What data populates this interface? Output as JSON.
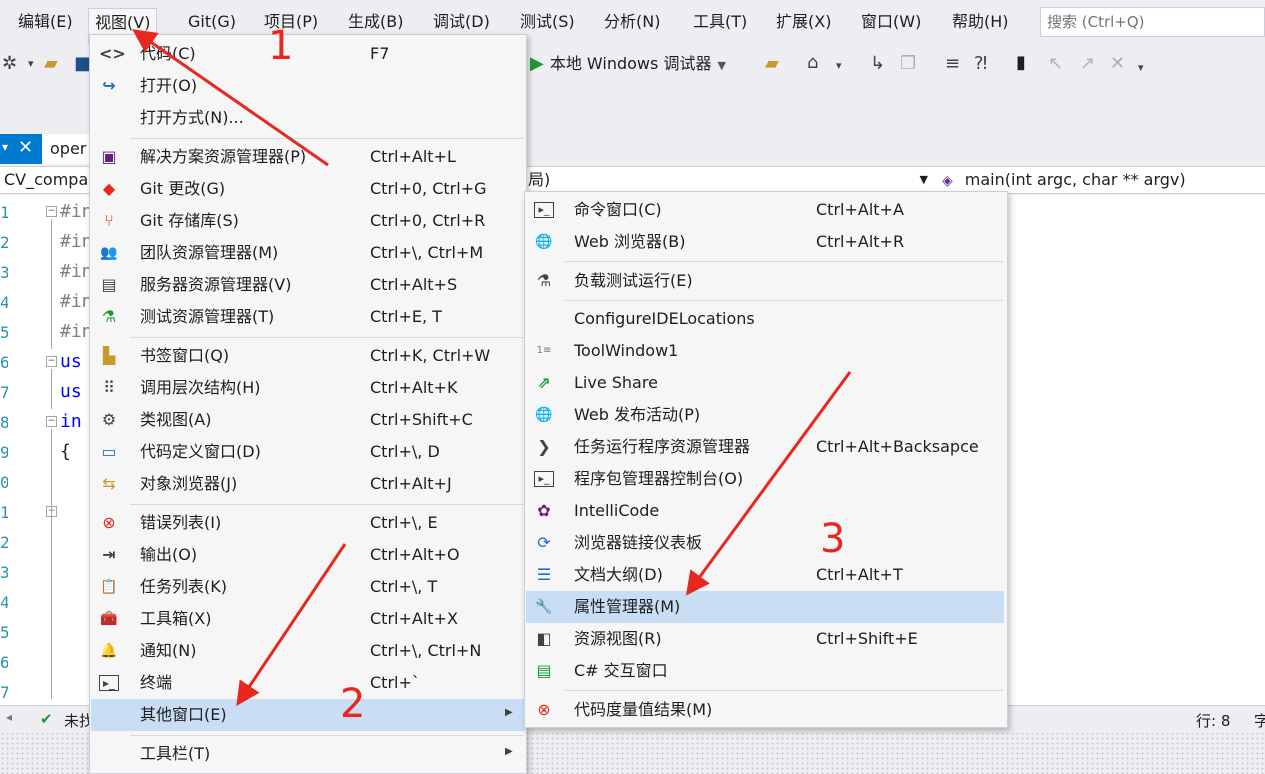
{
  "menubar": {
    "items": [
      {
        "label": "编辑(E)"
      },
      {
        "label": "视图(V)"
      },
      {
        "label": "Git(G)"
      },
      {
        "label": "项目(P)"
      },
      {
        "label": "生成(B)"
      },
      {
        "label": "调试(D)"
      },
      {
        "label": "测试(S)"
      },
      {
        "label": "分析(N)"
      },
      {
        "label": "工具(T)"
      },
      {
        "label": "扩展(X)"
      },
      {
        "label": "窗口(W)"
      },
      {
        "label": "帮助(H)"
      }
    ],
    "search_placeholder": "搜索 (Ctrl+Q)"
  },
  "toolbar": {
    "run_label": "本地 Windows 调试器"
  },
  "editor": {
    "tab_label": "oper",
    "nav_left": "CV_compar",
    "nav_mid": "局)",
    "nav_right": "main(int argc, char ** argv)",
    "line_numbers": [
      "1",
      "2",
      "3",
      "4",
      "5",
      "6",
      "7",
      "8",
      "9",
      "0",
      "1",
      "2",
      "3",
      "4",
      "5",
      "6",
      "7"
    ],
    "code_lines": [
      "#in",
      "#in",
      "#in",
      "#in",
      "#in",
      "us",
      "us",
      "in",
      "{"
    ],
    "status_text": "未找",
    "status_row": "行: 8",
    "status_extra": "字"
  },
  "view_menu": {
    "items": [
      {
        "icon": "code-icon",
        "glyph": "<>",
        "label": "代码(C)",
        "shortcut": "F7"
      },
      {
        "icon": "open-icon",
        "glyph": "↪",
        "label": "打开(O)",
        "shortcut": ""
      },
      {
        "icon": "",
        "glyph": "",
        "label": "打开方式(N)...",
        "shortcut": ""
      },
      {
        "icon": "solution-explorer-icon",
        "glyph": "▣",
        "label": "解决方案资源管理器(P)",
        "shortcut": "Ctrl+Alt+L"
      },
      {
        "icon": "git-changes-icon",
        "glyph": "◆",
        "label": "Git 更改(G)",
        "shortcut": "Ctrl+0, Ctrl+G"
      },
      {
        "icon": "git-repository-icon",
        "glyph": "⑂",
        "label": "Git 存储库(S)",
        "shortcut": "Ctrl+0, Ctrl+R"
      },
      {
        "icon": "team-explorer-icon",
        "glyph": "👥",
        "label": "团队资源管理器(M)",
        "shortcut": "Ctrl+\\, Ctrl+M"
      },
      {
        "icon": "server-explorer-icon",
        "glyph": "▤",
        "label": "服务器资源管理器(V)",
        "shortcut": "Ctrl+Alt+S"
      },
      {
        "icon": "test-explorer-icon",
        "glyph": "⚗",
        "label": "测试资源管理器(T)",
        "shortcut": "Ctrl+E, T"
      },
      {
        "icon": "bookmark-window-icon",
        "glyph": "▙",
        "label": "书签窗口(Q)",
        "shortcut": "Ctrl+K, Ctrl+W"
      },
      {
        "icon": "call-hierarchy-icon",
        "glyph": "⠿",
        "label": "调用层次结构(H)",
        "shortcut": "Ctrl+Alt+K"
      },
      {
        "icon": "class-view-icon",
        "glyph": "⚙",
        "label": "类视图(A)",
        "shortcut": "Ctrl+Shift+C"
      },
      {
        "icon": "code-definition-icon",
        "glyph": "▭",
        "label": "代码定义窗口(D)",
        "shortcut": "Ctrl+\\, D"
      },
      {
        "icon": "object-browser-icon",
        "glyph": "⇆",
        "label": "对象浏览器(J)",
        "shortcut": "Ctrl+Alt+J"
      },
      {
        "icon": "error-list-icon",
        "glyph": "⊗",
        "label": "错误列表(I)",
        "shortcut": "Ctrl+\\, E"
      },
      {
        "icon": "output-icon",
        "glyph": "⇥",
        "label": "输出(O)",
        "shortcut": "Ctrl+Alt+O"
      },
      {
        "icon": "task-list-icon",
        "glyph": "📋",
        "label": "任务列表(K)",
        "shortcut": "Ctrl+\\, T"
      },
      {
        "icon": "toolbox-icon",
        "glyph": "🧰",
        "label": "工具箱(X)",
        "shortcut": "Ctrl+Alt+X"
      },
      {
        "icon": "notification-bell-icon",
        "glyph": "🔔",
        "label": "通知(N)",
        "shortcut": "Ctrl+\\, Ctrl+N"
      },
      {
        "icon": "terminal-icon",
        "glyph": "▸_",
        "label": "终端",
        "shortcut": "Ctrl+`"
      },
      {
        "icon": "",
        "glyph": "",
        "label": "其他窗口(E)",
        "shortcut": ""
      },
      {
        "icon": "",
        "glyph": "",
        "label": "工具栏(T)",
        "shortcut": ""
      }
    ]
  },
  "other_windows_menu": {
    "items": [
      {
        "icon": "command-window-icon",
        "glyph": "▸_",
        "label": "命令窗口(C)",
        "shortcut": "Ctrl+Alt+A"
      },
      {
        "icon": "web-browser-icon",
        "glyph": "🌐",
        "label": "Web 浏览器(B)",
        "shortcut": "Ctrl+Alt+R"
      },
      {
        "icon": "load-test-icon",
        "glyph": "⚗",
        "label": "负载测试运行(E)",
        "shortcut": ""
      },
      {
        "icon": "",
        "glyph": "",
        "label": "ConfigureIDELocations",
        "shortcut": ""
      },
      {
        "icon": "tool-window-icon",
        "glyph": "1≡",
        "label": "ToolWindow1",
        "shortcut": ""
      },
      {
        "icon": "live-share-icon",
        "glyph": "⇗",
        "label": "Live Share",
        "shortcut": ""
      },
      {
        "icon": "web-publish-icon",
        "glyph": "🌐",
        "label": "Web 发布活动(P)",
        "shortcut": ""
      },
      {
        "icon": "task-runner-icon",
        "glyph": "❯",
        "label": "任务运行程序资源管理器",
        "shortcut": "Ctrl+Alt+Backsapce"
      },
      {
        "icon": "package-manager-console-icon",
        "glyph": "▸_",
        "label": "程序包管理器控制台(O)",
        "shortcut": ""
      },
      {
        "icon": "intellicode-icon",
        "glyph": "✿",
        "label": "IntelliCode",
        "shortcut": ""
      },
      {
        "icon": "browser-link-icon",
        "glyph": "⟳",
        "label": "浏览器链接仪表板",
        "shortcut": ""
      },
      {
        "icon": "document-outline-icon",
        "glyph": "☰",
        "label": "文档大纲(D)",
        "shortcut": "Ctrl+Alt+T"
      },
      {
        "icon": "wrench-icon",
        "glyph": "🔧",
        "label": "属性管理器(M)",
        "shortcut": ""
      },
      {
        "icon": "resource-view-icon",
        "glyph": "◧",
        "label": "资源视图(R)",
        "shortcut": "Ctrl+Shift+E"
      },
      {
        "icon": "csharp-interactive-icon",
        "glyph": "▤",
        "label": "C# 交互窗口",
        "shortcut": ""
      },
      {
        "icon": "code-metrics-icon",
        "glyph": "⊗",
        "label": "代码度量值结果(M)",
        "shortcut": ""
      }
    ]
  },
  "annotations": {
    "step1": "1",
    "step2": "2",
    "step3": "3",
    "color": "#e8281e"
  }
}
